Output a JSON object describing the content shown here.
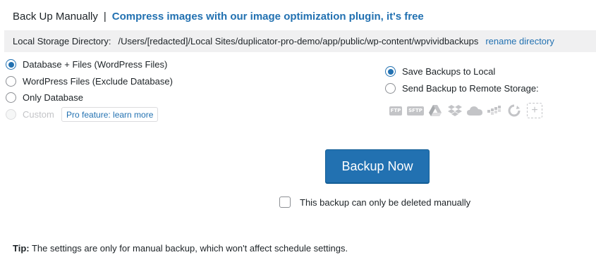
{
  "header": {
    "title": "Back Up Manually",
    "separator": "|",
    "promo_link": "Compress images with our image optimization plugin, it's free"
  },
  "storage": {
    "label": "Local Storage Directory:",
    "path": "/Users/[redacted]/Local Sites/duplicator-pro-demo/app/public/wp-content/wpvividbackups",
    "rename_link": "rename directory"
  },
  "backup_content": {
    "options": [
      {
        "label": "Database + Files (WordPress Files)",
        "checked": true,
        "disabled": false
      },
      {
        "label": "WordPress Files (Exclude Database)",
        "checked": false,
        "disabled": false
      },
      {
        "label": "Only Database",
        "checked": false,
        "disabled": false
      },
      {
        "label": "Custom",
        "checked": false,
        "disabled": true
      }
    ],
    "pro_badge": "Pro feature: learn more"
  },
  "destination": {
    "options": [
      {
        "label": "Save Backups to Local",
        "checked": true
      },
      {
        "label": "Send Backup to Remote Storage:",
        "checked": false
      }
    ],
    "remote_icons": [
      {
        "name": "ftp-icon",
        "text": "FTP"
      },
      {
        "name": "sftp-icon",
        "text": "SFTP"
      },
      {
        "name": "google-drive-icon",
        "text": ""
      },
      {
        "name": "dropbox-icon",
        "text": ""
      },
      {
        "name": "onedrive-icon",
        "text": ""
      },
      {
        "name": "amazon-s3-icon",
        "text": ""
      },
      {
        "name": "backblaze-icon",
        "text": ""
      },
      {
        "name": "add-storage-icon",
        "text": "+"
      }
    ]
  },
  "actions": {
    "backup_button": "Backup Now",
    "manual_delete_label": "This backup can only be deleted manually"
  },
  "tip": {
    "prefix": "Tip:",
    "text": "The settings are only for manual backup, which won't affect schedule settings."
  },
  "colors": {
    "accent": "#2271b1",
    "bar_bg": "#f0f0f1",
    "icon_gray": "#c3c4c7"
  }
}
